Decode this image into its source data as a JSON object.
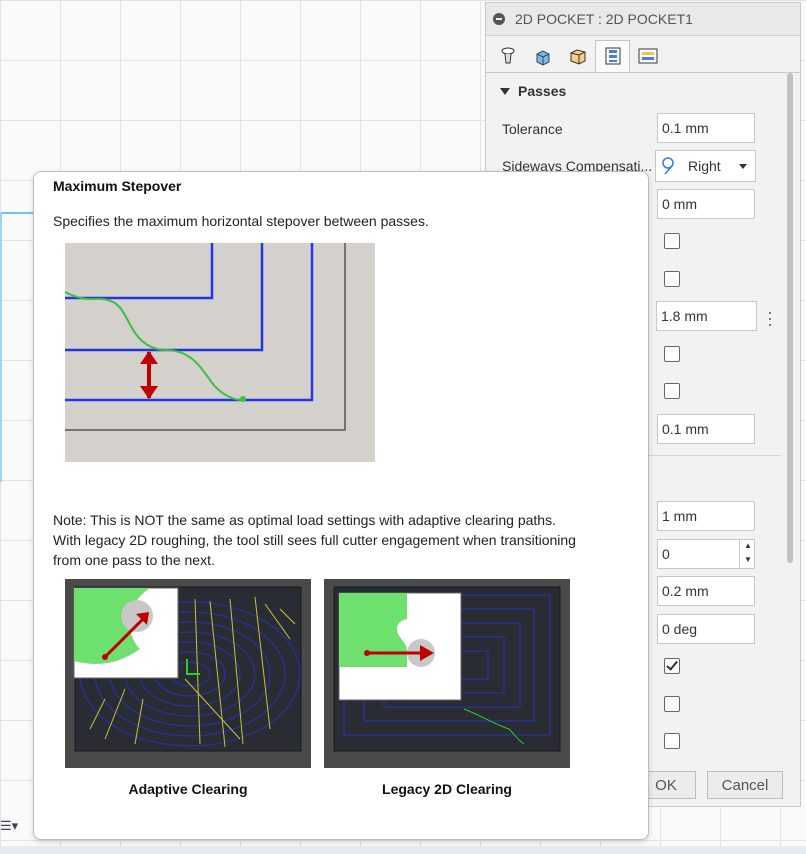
{
  "panel": {
    "title": "2D POCKET : 2D POCKET1",
    "tabs": [
      {
        "icon": "tool-icon"
      },
      {
        "icon": "geometry-icon"
      },
      {
        "icon": "heights-icon"
      },
      {
        "icon": "passes-icon",
        "active": true
      },
      {
        "icon": "linking-icon"
      }
    ],
    "section_title": "Passes",
    "tolerance_label": "Tolerance",
    "tolerance_value": "0.1 mm",
    "sideways_label": "Sideways Compensati...",
    "sideways_value": "Right",
    "field_0mm": "0 mm",
    "field_max_stepover": "1.8 mm",
    "field_01mm": "0.1 mm",
    "field_1mm": "1 mm",
    "field_count": "0",
    "field_02mm": "0.2 mm",
    "field_0deg": "0 deg",
    "checkboxes": [
      false,
      false,
      false,
      false,
      true,
      false,
      false
    ],
    "ok_label": "OK",
    "cancel_label": "Cancel"
  },
  "tooltip": {
    "title": "Maximum Stepover",
    "description": "Specifies the maximum horizontal stepover between passes.",
    "note_line1": "Note: This is NOT the same as optimal load settings with adaptive clearing paths.",
    "note_line2": "With legacy 2D roughing, the tool still sees full cutter engagement when transitioning",
    "note_line3": "from one pass to the next.",
    "caption_adaptive": "Adaptive Clearing",
    "caption_legacy": "Legacy 2D Clearing"
  },
  "colors": {
    "toolpath_blue": "#1f2fe0",
    "arrow_red": "#c00000",
    "material_green": "#6de06d"
  }
}
